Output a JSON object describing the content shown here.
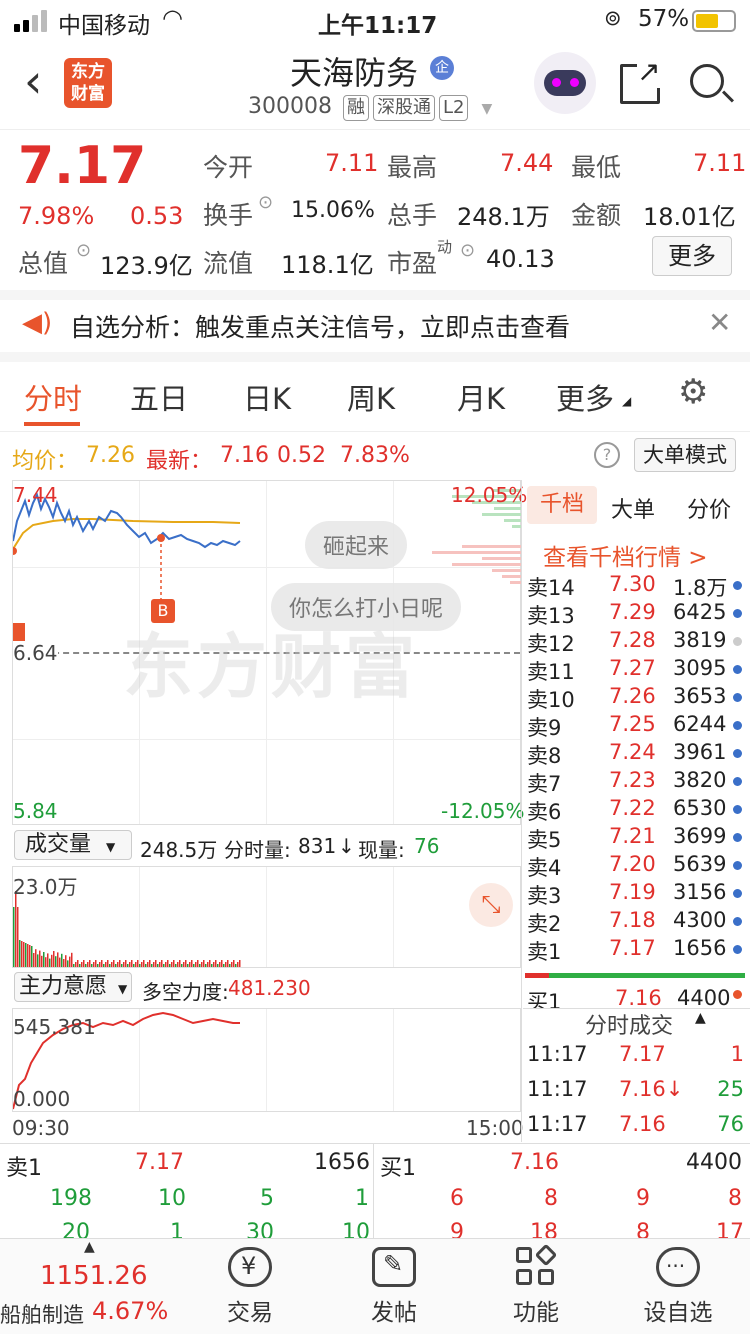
{
  "status": {
    "carrier": "中国移动",
    "time": "上午11:17",
    "battery": "57%"
  },
  "header": {
    "title": "天海防务",
    "code": "300008",
    "tags": [
      "融",
      "深股通",
      "L2"
    ],
    "logo_top": "东方",
    "logo_bottom": "财富"
  },
  "quote": {
    "price": "7.17",
    "change_pct": "7.98%",
    "change": "0.53",
    "open_label": "今开",
    "open": "7.11",
    "high_label": "最高",
    "high": "7.44",
    "low_label": "最低",
    "low": "7.11",
    "turnover_label": "换手",
    "turnover": "15.06%",
    "volume_label": "总手",
    "volume": "248.1万",
    "amount_label": "金额",
    "amount": "18.01亿",
    "mktcap_label": "总值",
    "mktcap": "123.9亿",
    "float_label": "流值",
    "float": "118.1亿",
    "pe_label": "市盈",
    "pe_sup": "动",
    "pe": "40.13",
    "more": "更多"
  },
  "banner": {
    "text": "自选分析：触发重点关注信号，立即点击查看"
  },
  "tabs": [
    "分时",
    "五日",
    "日K",
    "周K",
    "月K",
    "更多"
  ],
  "info": {
    "avg_label": "均价：",
    "avg": "7.26",
    "latest_label": "最新：",
    "latest": "7.16",
    "chg": "0.52",
    "pct": "7.83%",
    "mode": "大单模式"
  },
  "chart": {
    "top_price": "7.44",
    "top_pct": "12.05%",
    "mid_price": "6.64",
    "bot_price": "5.84",
    "bot_pct": "-12.05%",
    "bubble1": "砸起来",
    "bubble2": "你怎么打小日呢",
    "marker": "B",
    "watermark": "东方财富"
  },
  "volume": {
    "label": "成交量",
    "total": "248.5万",
    "tick_label": "分时量:",
    "tick": "831",
    "arrow": "↓",
    "now_label": "现量:",
    "now": "76",
    "max": "23.0万"
  },
  "flow": {
    "label": "主力意愿",
    "power_label": "多空力度:",
    "power": "481.230",
    "max": "545.381",
    "min": "0.000",
    "start": "09:30",
    "end": "15:00"
  },
  "side": {
    "tabs": [
      "千档",
      "大单",
      "分价"
    ],
    "link": "查看千档行情 >",
    "asks": [
      {
        "label": "卖14",
        "price": "7.30",
        "vol": "1.8万"
      },
      {
        "label": "卖13",
        "price": "7.29",
        "vol": "6425"
      },
      {
        "label": "卖12",
        "price": "7.28",
        "vol": "3819"
      },
      {
        "label": "卖11",
        "price": "7.27",
        "vol": "3095"
      },
      {
        "label": "卖10",
        "price": "7.26",
        "vol": "3653"
      },
      {
        "label": "卖9",
        "price": "7.25",
        "vol": "6244"
      },
      {
        "label": "卖8",
        "price": "7.24",
        "vol": "3961"
      },
      {
        "label": "卖7",
        "price": "7.23",
        "vol": "3820"
      },
      {
        "label": "卖6",
        "price": "7.22",
        "vol": "6530"
      },
      {
        "label": "卖5",
        "price": "7.21",
        "vol": "3699"
      },
      {
        "label": "卖4",
        "price": "7.20",
        "vol": "5639"
      },
      {
        "label": "卖3",
        "price": "7.19",
        "vol": "3156"
      },
      {
        "label": "卖2",
        "price": "7.18",
        "vol": "4300"
      },
      {
        "label": "卖1",
        "price": "7.17",
        "vol": "1656"
      }
    ],
    "bid1": {
      "label": "买1",
      "price": "7.16",
      "vol": "4400"
    },
    "ticks_title": "分时成交",
    "ticks": [
      {
        "time": "11:17",
        "price": "7.17",
        "vol": "1"
      },
      {
        "time": "11:17",
        "price": "7.16↓",
        "vol": "25"
      },
      {
        "time": "11:17",
        "price": "7.16",
        "vol": "76"
      }
    ]
  },
  "bottom_book": {
    "ask_label": "卖1",
    "ask_price": "7.17",
    "ask_vol": "1656",
    "bid_label": "买1",
    "bid_price": "7.16",
    "bid_vol": "4400",
    "ask_row1": [
      "198",
      "10",
      "5",
      "1"
    ],
    "ask_row2": [
      "20",
      "1",
      "30",
      "10"
    ],
    "bid_row1": [
      "6",
      "8",
      "9",
      "8"
    ],
    "bid_row2": [
      "9",
      "18",
      "8",
      "17"
    ]
  },
  "nav": {
    "index_value": "1151.26",
    "index_name": "船舶制造",
    "index_pct": "4.67%",
    "items": [
      "交易",
      "发帖",
      "功能",
      "设自选"
    ]
  }
}
